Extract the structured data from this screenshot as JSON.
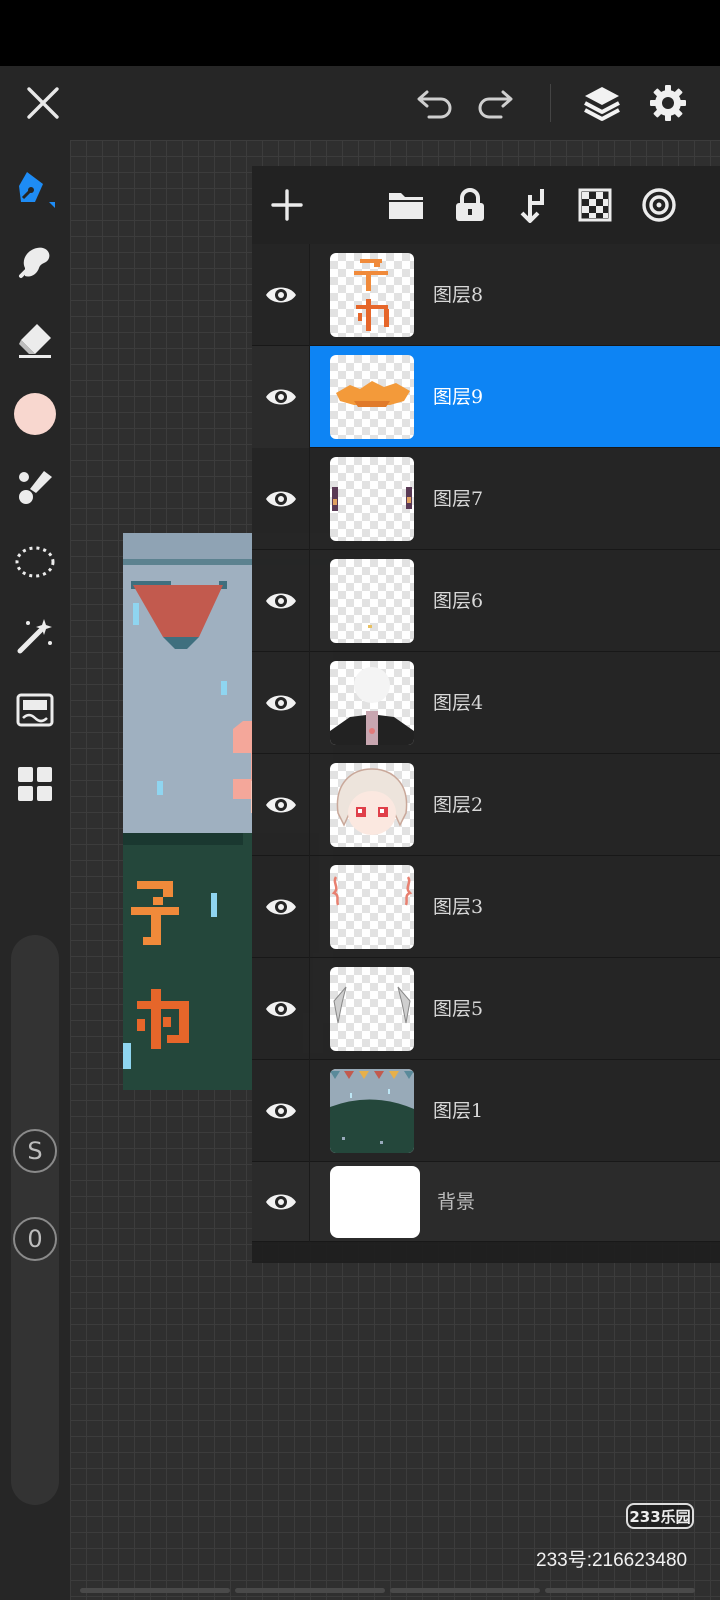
{
  "toolbar": {
    "close_icon": "close-icon",
    "undo_icon": "undo-icon",
    "redo_icon": "redo-icon",
    "layers_icon": "layers-icon",
    "settings_icon": "gear-icon"
  },
  "tools": {
    "current_color": "#f8d7cf",
    "accent": "#0d84f4",
    "slider_badges": [
      "S",
      "0"
    ]
  },
  "layers_panel": {
    "header_icons": [
      "add-icon",
      "folder-icon",
      "lock-icon",
      "merge-down-icon",
      "transparency-icon",
      "blend-icon"
    ],
    "layers": [
      {
        "name": "图层8",
        "selected": false
      },
      {
        "name": "图层9",
        "selected": true
      },
      {
        "name": "图层7",
        "selected": false
      },
      {
        "name": "图层6",
        "selected": false
      },
      {
        "name": "图层4",
        "selected": false
      },
      {
        "name": "图层2",
        "selected": false
      },
      {
        "name": "图层3",
        "selected": false
      },
      {
        "name": "图层5",
        "selected": false
      },
      {
        "name": "图层1",
        "selected": false
      }
    ],
    "background_layer": {
      "name": "背景"
    }
  },
  "watermark": {
    "logo": "233乐园",
    "id_text": "233号:216623480"
  }
}
